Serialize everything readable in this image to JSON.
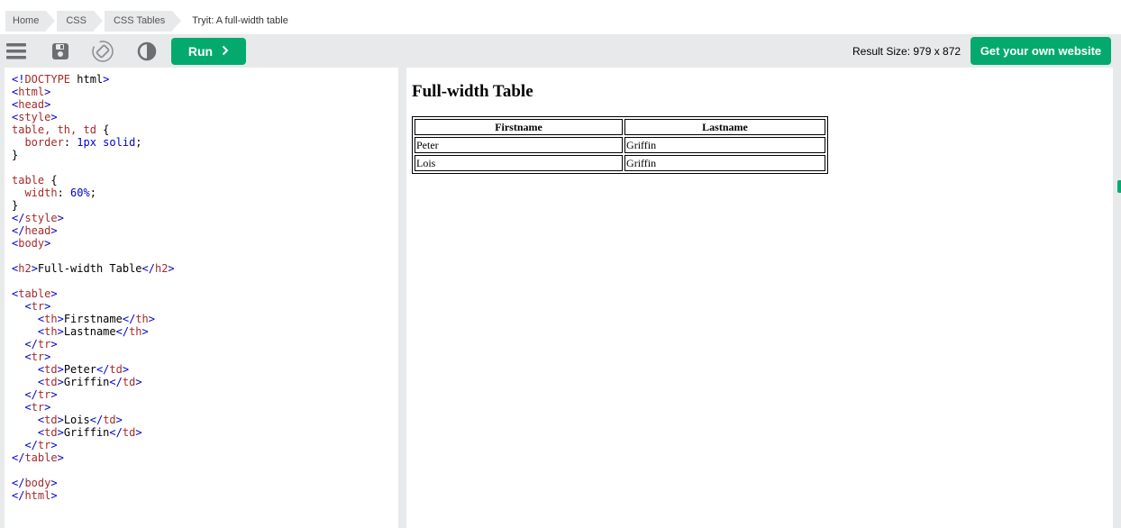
{
  "breadcrumb": {
    "items": [
      "Home",
      "CSS",
      "CSS Tables"
    ],
    "current": "Tryit: A full-width table"
  },
  "toolbar": {
    "icons": [
      "menu-icon",
      "save-icon",
      "rotate-icon",
      "contrast-icon"
    ],
    "run_label": "Run",
    "result_size": "Result Size: 979 x 872",
    "get_website_label": "Get your own website"
  },
  "colors": {
    "accent": "#04aa6d",
    "toolbar_bg": "#e7e9eb",
    "tag": "#a52a2a",
    "bracket": "#0000cd"
  },
  "code": {
    "lines": [
      "<!DOCTYPE html>",
      "<html>",
      "<head>",
      "<style>",
      "table, th, td {",
      "  border: 1px solid;",
      "}",
      "",
      "table {",
      "  width: 60%;",
      "}",
      "</style>",
      "</head>",
      "<body>",
      "",
      "<h2>Full-width Table</h2>",
      "",
      "<table>",
      "  <tr>",
      "    <th>Firstname</th>",
      "    <th>Lastname</th>",
      "  </tr>",
      "  <tr>",
      "    <td>Peter</td>",
      "    <td>Griffin</td>",
      "  </tr>",
      "  <tr>",
      "    <td>Lois</td>",
      "    <td>Griffin</td>",
      "  </tr>",
      "</table>",
      "",
      "</body>",
      "</html>"
    ]
  },
  "result": {
    "title": "Full-width Table",
    "table": {
      "headers": [
        "Firstname",
        "Lastname"
      ],
      "rows": [
        [
          "Peter",
          "Griffin"
        ],
        [
          "Lois",
          "Griffin"
        ]
      ]
    }
  }
}
